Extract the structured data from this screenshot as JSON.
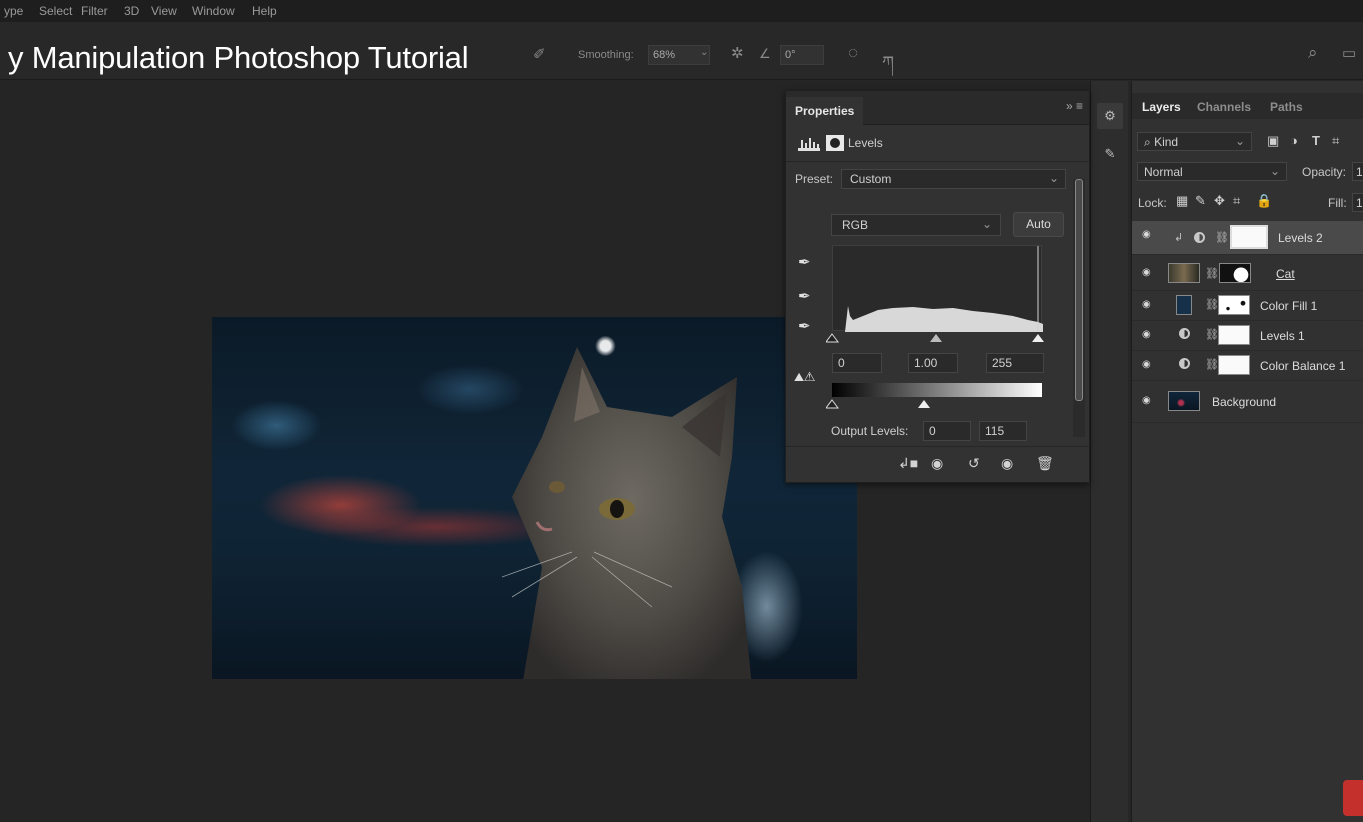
{
  "menu": [
    "ype",
    "Select",
    "Filter",
    "3D",
    "View",
    "Window",
    "Help"
  ],
  "video_title": "y Manipulation Photoshop Tutorial",
  "options": {
    "smoothing_label": "Smoothing:",
    "smoothing_value": "68%",
    "angle_value": "0°"
  },
  "properties": {
    "tab": "Properties",
    "adjustment": "Levels",
    "preset_label": "Preset:",
    "preset_value": "Custom",
    "channel": "RGB",
    "auto_label": "Auto",
    "input_black": "0",
    "input_gamma": "1.00",
    "input_white": "255",
    "output_label": "Output Levels:",
    "output_black": "0",
    "output_white": "115"
  },
  "layers_panel": {
    "tabs": [
      "Layers",
      "Channels",
      "Paths"
    ],
    "filter_label": "Kind",
    "blend_mode": "Normal",
    "opacity_label": "Opacity:",
    "opacity_value": "1",
    "lock_label": "Lock:",
    "fill_label": "Fill:",
    "fill_value": "1",
    "layers": [
      {
        "name": "Levels 2",
        "selected": true
      },
      {
        "name": "Cat",
        "selected": false
      },
      {
        "name": "Color Fill 1",
        "selected": false
      },
      {
        "name": "Levels 1",
        "selected": false
      },
      {
        "name": "Color Balance 1",
        "selected": false
      },
      {
        "name": "Background",
        "selected": false
      }
    ]
  },
  "colors": {
    "panel_bg": "#323232",
    "canvas_bg": "#252525",
    "selected_layer": "#4a4a4a",
    "color_fill_swatch": "#163049"
  },
  "icons": [
    "smoothing-icon",
    "gear-icon",
    "angle-icon",
    "pressure-icon",
    "symmetry-icon",
    "search-icon",
    "eye-icon",
    "link-icon",
    "eyedropper-icon",
    "trash-icon"
  ]
}
